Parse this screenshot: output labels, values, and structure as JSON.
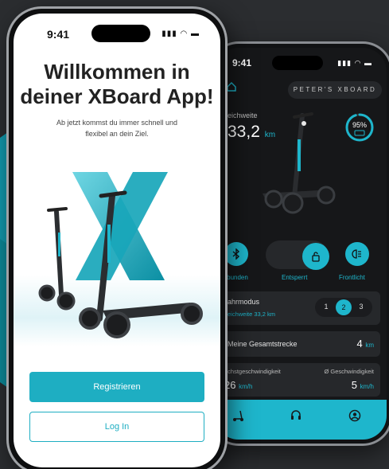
{
  "front": {
    "status_time": "9:41",
    "title_line1": "Willkommen in",
    "title_line2": "deiner XBoard App!",
    "subtitle_line1": "Ab jetzt kommst du immer schnell und",
    "subtitle_line2": "flexibel an dein Ziel.",
    "register_label": "Registrieren",
    "login_label": "Log In"
  },
  "back": {
    "status_time": "9:41",
    "badge": "PETER'S XBOARD",
    "range_label": "eichweite",
    "range_value": "33,2",
    "range_unit": "km",
    "battery": "95%",
    "battery_level": 0.95,
    "ctrl_connected": "erbunden",
    "ctrl_unlocked": "Entsperrt",
    "ctrl_frontlight": "Frontlicht",
    "mode_title": "ahrmodus",
    "mode_sub": "eichweite 33,2 km",
    "gears": [
      "1",
      "2",
      "3"
    ],
    "gear_active": "2",
    "total_title": "Meine Gesamtstrecke",
    "total_value": "4",
    "total_unit": "km",
    "max_label": "öchstgeschwindigkeit",
    "max_value": "26",
    "max_unit": "km/h",
    "avg_label": "Ø Geschwindigkeit",
    "avg_value": "5",
    "avg_unit": "km/h"
  },
  "colors": {
    "accent": "#1eb6cc",
    "background": "#2b2d30",
    "dark_screen": "#161719",
    "card": "#26282b"
  }
}
